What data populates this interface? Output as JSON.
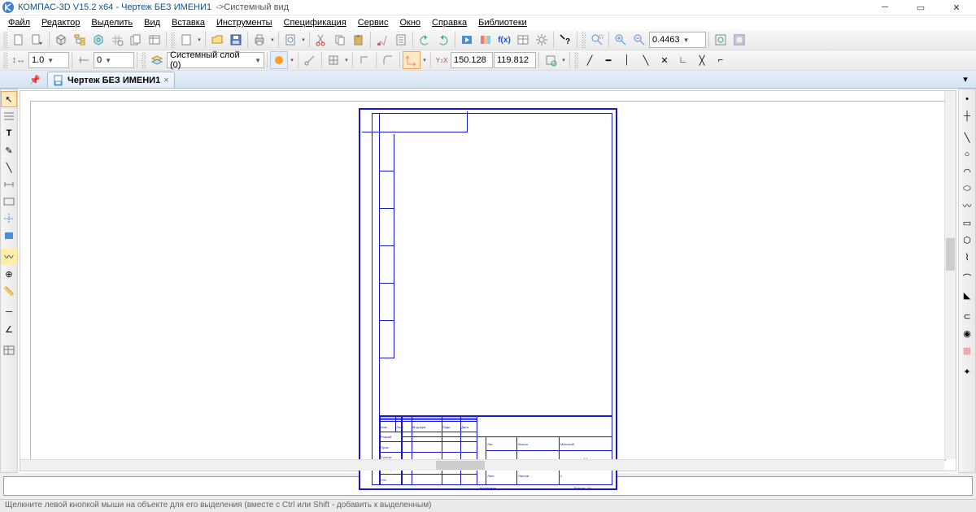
{
  "title": {
    "app": "КОМПАС-3D V15.2  x64",
    "doc": "Чертеж БЕЗ ИМЕНИ1",
    "view": "Системный вид"
  },
  "menu": {
    "file": "Файл",
    "editor": "Редактор",
    "select": "Выделить",
    "view": "Вид",
    "insert": "Вставка",
    "tools": "Инструменты",
    "spec": "Спецификация",
    "service": "Сервис",
    "window": "Окно",
    "help": "Справка",
    "libs": "Библиотеки"
  },
  "toolbar1": {
    "zoom_value": "0.4463"
  },
  "toolbar2": {
    "step": "1.0",
    "offset": "0",
    "layer": "Системный слой (0)",
    "coord_x": "150.128",
    "coord_y": "119.812"
  },
  "tab": {
    "name": "Чертеж БЕЗ ИМЕНИ1"
  },
  "title_block": {
    "col_lit": "Лит.",
    "col_mass": "Масса",
    "col_scale": "Масштаб",
    "scale": "1:1",
    "sheet": "Лист",
    "sheets": "Листов",
    "sheets_val": "1",
    "format": "Формат",
    "a4": "А4",
    "razrab": "Разраб.",
    "prov": "Пров.",
    "tkontr": "Т.контр.",
    "izmno": "Изм.",
    "listno": "Лист",
    "ndokum": "№ докум.",
    "podp": "Подп.",
    "data": "Дата",
    "nkontr": "Н.контр.",
    "utv": "Утв.",
    "copied": "Копировал"
  },
  "status": {
    "hint": "Щелкните левой кнопкой мыши на объекте для его выделения (вместе с Ctrl или Shift - добавить к выделенным)"
  }
}
